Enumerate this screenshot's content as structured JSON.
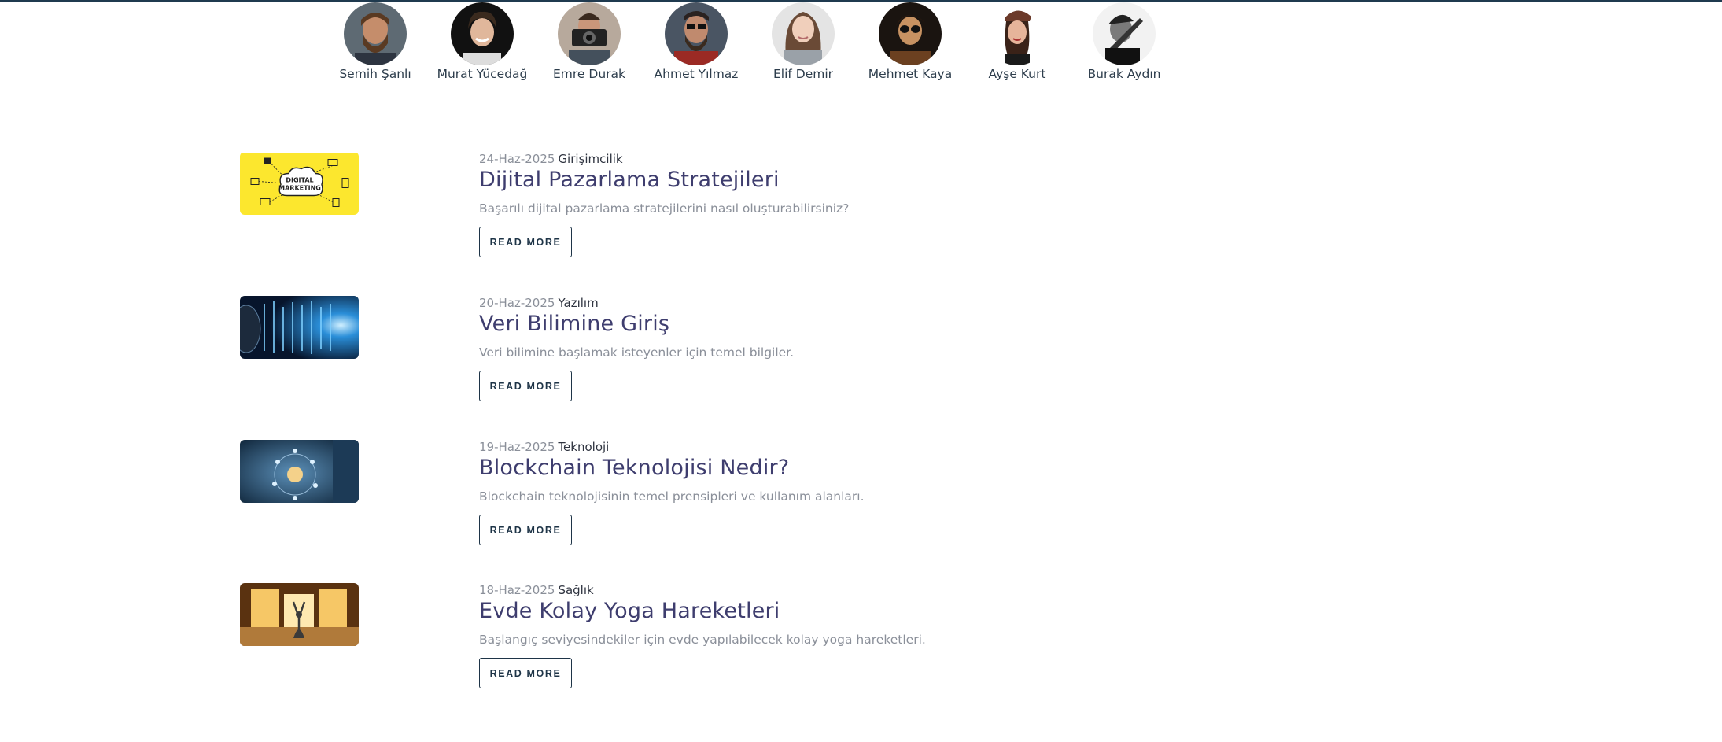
{
  "authors": [
    {
      "name": "Semih Şanlı"
    },
    {
      "name": "Murat Yücedağ"
    },
    {
      "name": "Emre Durak"
    },
    {
      "name": "Ahmet Yılmaz"
    },
    {
      "name": "Elif Demir"
    },
    {
      "name": "Mehmet Kaya"
    },
    {
      "name": "Ayşe Kurt"
    },
    {
      "name": "Burak Aydın"
    }
  ],
  "posts": [
    {
      "date": "24-Haz-2025",
      "category": "Girişimcilik",
      "title": "Dijital Pazarlama Stratejileri",
      "excerpt": "Başarılı dijital pazarlama stratejilerini nasıl oluşturabilirsiniz?",
      "button": "READ MORE",
      "thumb_text_1": "DIGITAL",
      "thumb_text_2": "MARKETING"
    },
    {
      "date": "20-Haz-2025",
      "category": "Yazılım",
      "title": "Veri Bilimine Giriş",
      "excerpt": "Veri bilimine başlamak isteyenler için temel bilgiler.",
      "button": "READ MORE"
    },
    {
      "date": "19-Haz-2025",
      "category": "Teknoloji",
      "title": "Blockchain Teknolojisi Nedir?",
      "excerpt": "Blockchain teknolojisinin temel prensipleri ve kullanım alanları.",
      "button": "READ MORE"
    },
    {
      "date": "18-Haz-2025",
      "category": "Sağlık",
      "title": "Evde Kolay Yoga Hareketleri",
      "excerpt": "Başlangıç seviyesindekiler için evde yapılabilecek kolay yoga hareketleri.",
      "button": "READ MORE"
    }
  ],
  "colors": {
    "accent_border": "#1f3a4f",
    "title": "#3e3d6e",
    "muted_text": "#8a8f99",
    "button_border": "#1e3447"
  }
}
